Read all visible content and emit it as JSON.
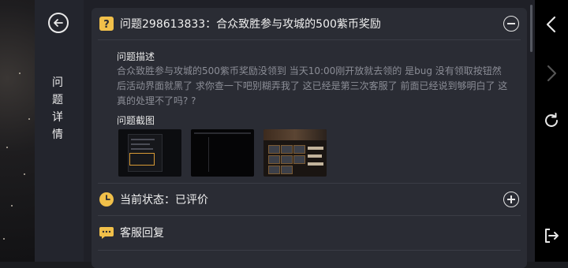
{
  "side_panel": {
    "title_chars": [
      "问",
      "题",
      "详",
      "情"
    ]
  },
  "issue": {
    "title": "问题298613833：合众致胜参与攻城的500紫币奖励",
    "description_label": "问题描述",
    "description": "合众致胜参与攻城的500紫币奖励没领到 当天10:00刚开放就去领的 是bug 没有领取按钮然后活动界面就黑了 求你查一下吧别糊弄我了 这已经是第三次客服了 前面已经说到够明白了 这真的处理不了吗? ?",
    "screenshot_label": "问题截图"
  },
  "status": {
    "text": "当前状态：已评价"
  },
  "reply": {
    "text": "客服回复"
  },
  "colors": {
    "accent": "#f1c04a",
    "panel": "#2a2c34",
    "muted_text": "#8b8d96"
  }
}
